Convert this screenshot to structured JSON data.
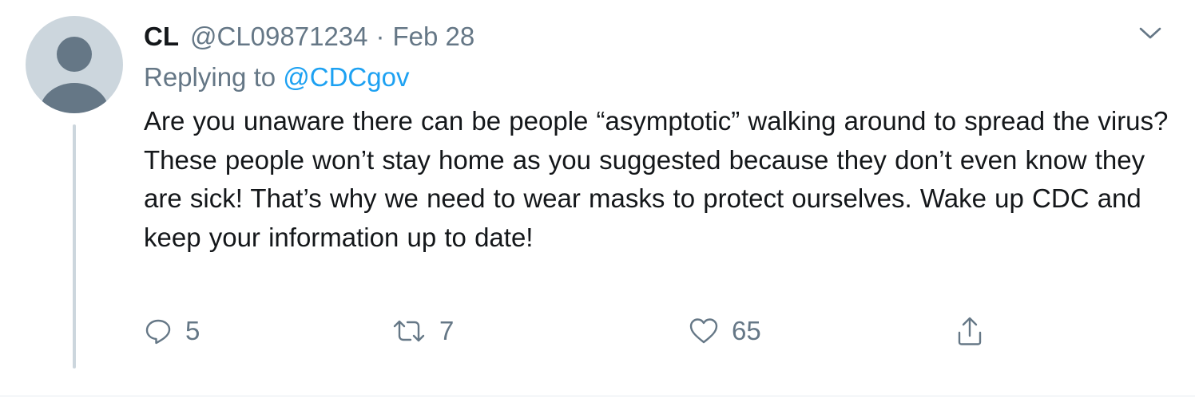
{
  "tweet": {
    "author_name": "CL",
    "author_handle": "@CL09871234",
    "separator": "·",
    "date": "Feb 28",
    "replying_prefix": "Replying to ",
    "replying_to": "@CDCgov",
    "text": "Are you unaware there can be people “asymptotic” walking around to spread the virus? These people won’t stay home as you suggested because they don’t even know they are sick! That’s why we need to wear masks to protect ourselves. Wake up CDC and keep your information up to date!"
  },
  "actions": {
    "reply_icon": "reply-bubble-icon",
    "reply_count": "5",
    "retweet_icon": "retweet-icon",
    "retweet_count": "7",
    "like_icon": "heart-icon",
    "like_count": "65",
    "share_icon": "share-upload-icon"
  },
  "colors": {
    "text": "#14171a",
    "secondary": "#657786",
    "link": "#1da1f2",
    "avatar_bg": "#ccd6dd",
    "avatar_figure": "#657786"
  }
}
